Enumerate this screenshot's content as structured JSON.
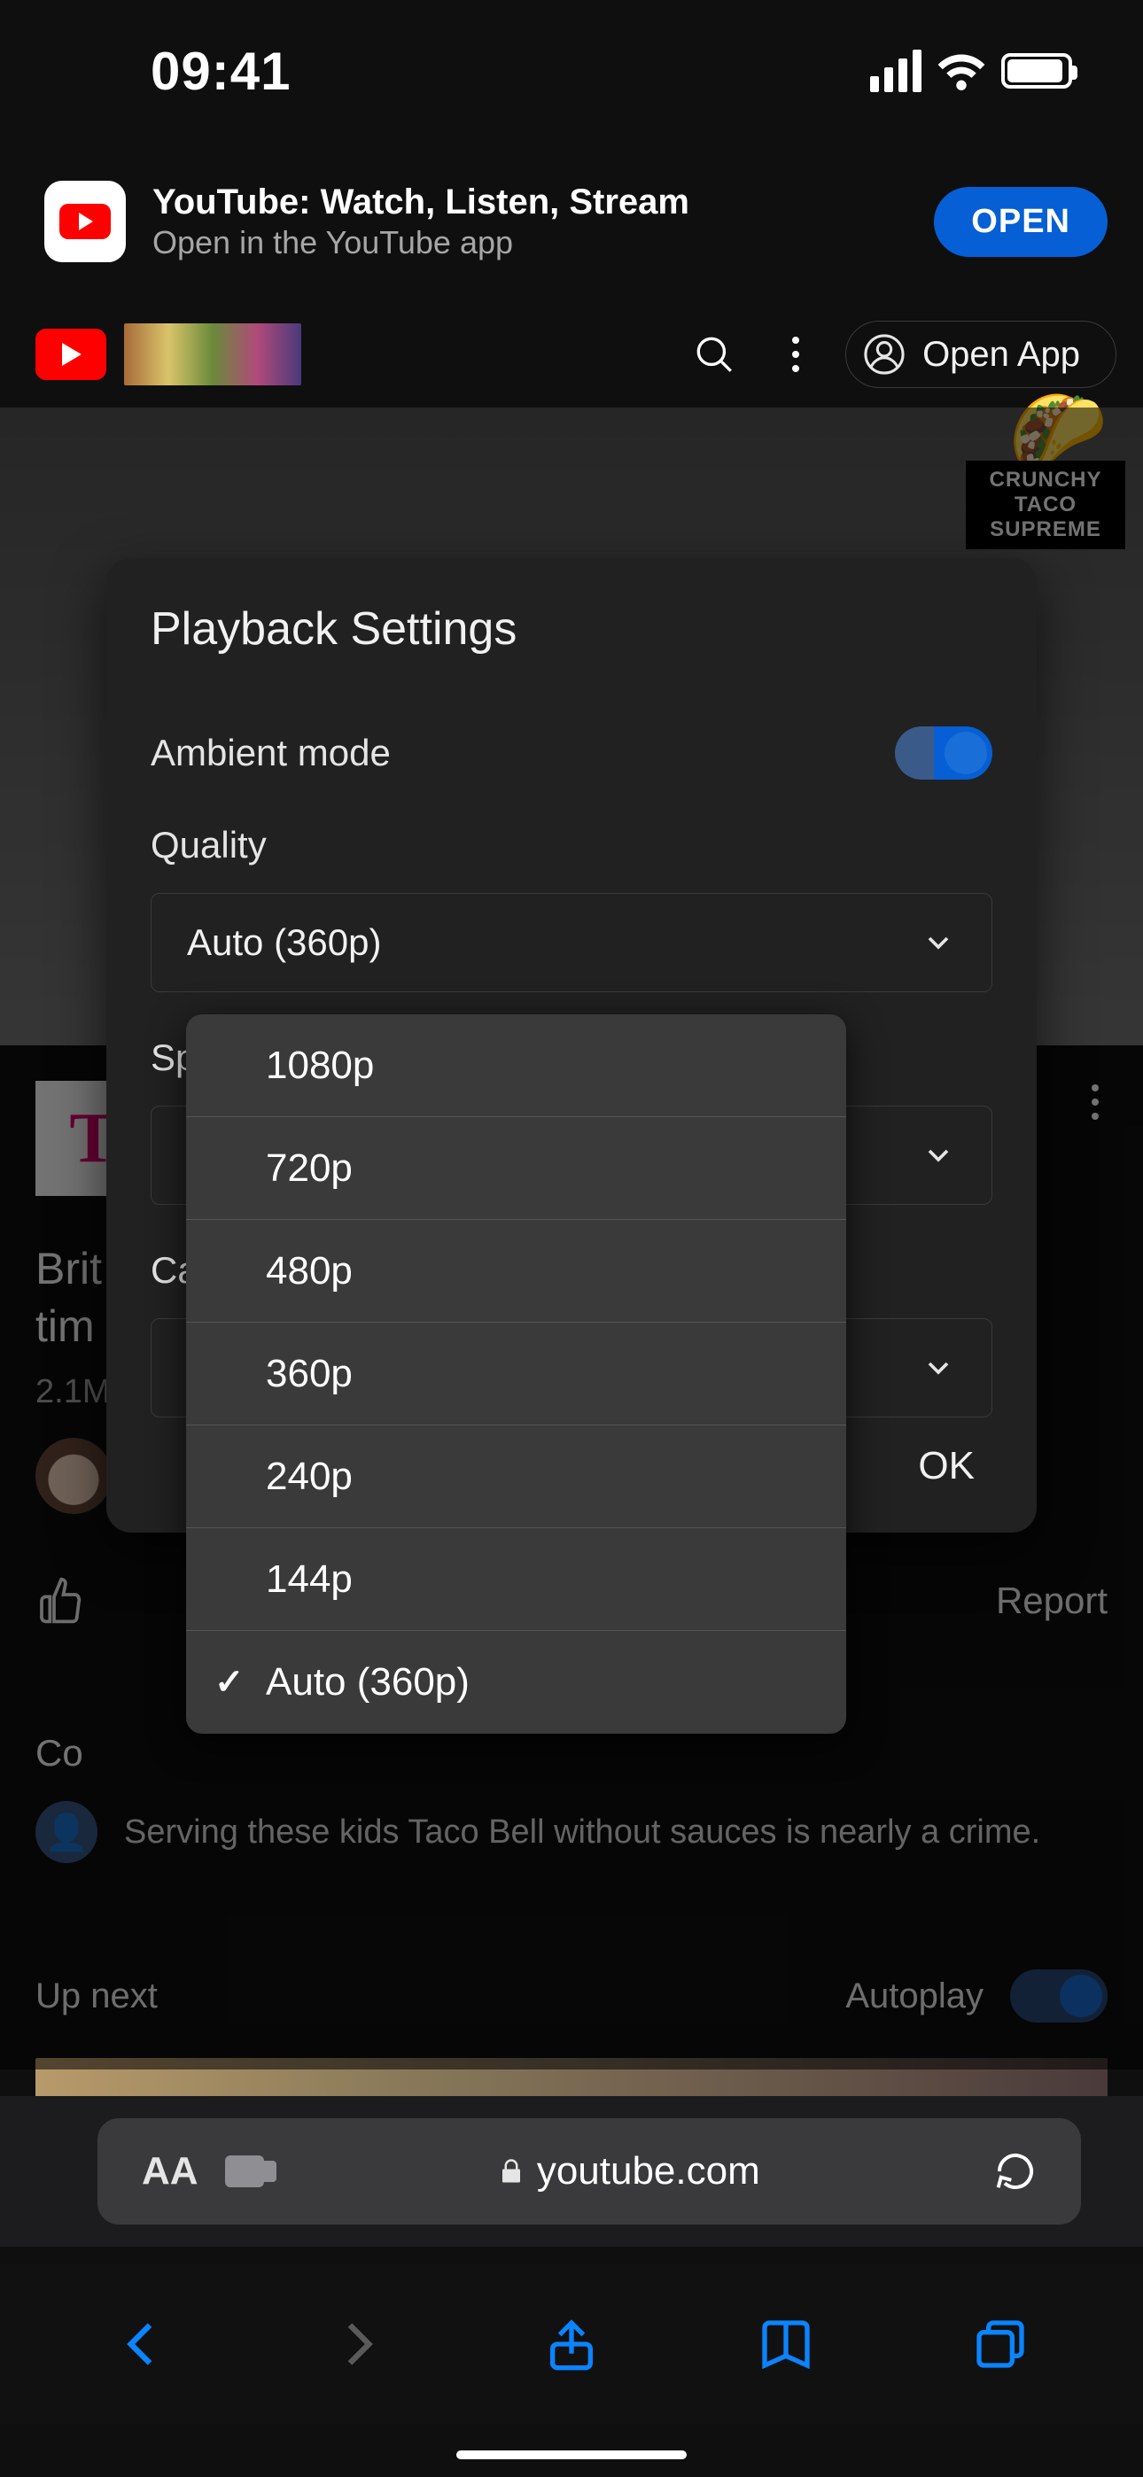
{
  "status": {
    "time": "09:41"
  },
  "banner": {
    "title": "YouTube: Watch, Listen, Stream",
    "subtitle": "Open in the YouTube app",
    "open_label": "OPEN"
  },
  "header": {
    "open_app_label": "Open App"
  },
  "video": {
    "badge_line1": "CRUNCHY TACO",
    "badge_line2": "SUPREME",
    "taco_emoji": "🌮"
  },
  "below": {
    "sponsor_letter": "T",
    "title_partial": "Brit\ntim",
    "views_partial": "2.1M",
    "report_label": "Report",
    "comments_label_partial": "Co",
    "comment_text": "Serving these kids Taco Bell without sauces is nearly a crime.",
    "upnext_label": "Up next",
    "autoplay_label": "Autoplay"
  },
  "panel": {
    "title": "Playback Settings",
    "ambient_label": "Ambient mode",
    "quality_label": "Quality",
    "quality_value": "Auto (360p)",
    "speed_label_partial": "Sp",
    "captions_label_partial": "Ca",
    "ok_label": "OK"
  },
  "dropdown": {
    "items": [
      {
        "label": "1080p",
        "selected": false
      },
      {
        "label": "720p",
        "selected": false
      },
      {
        "label": "480p",
        "selected": false
      },
      {
        "label": "360p",
        "selected": false
      },
      {
        "label": "240p",
        "selected": false
      },
      {
        "label": "144p",
        "selected": false
      },
      {
        "label": "Auto (360p)",
        "selected": true
      }
    ]
  },
  "safari": {
    "aa_label": "AA",
    "domain": "youtube.com"
  }
}
